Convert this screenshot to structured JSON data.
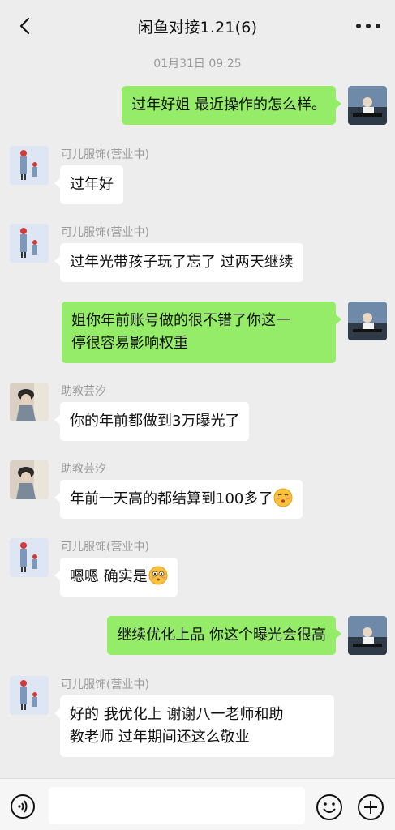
{
  "header": {
    "title": "闲鱼对接1.21(6)",
    "back_icon": "back-chevron-icon",
    "more_icon": "more-dots-icon"
  },
  "chat": {
    "timestamp": "01月31日 09:25",
    "messages": [
      {
        "side": "right",
        "text": "过年好姐 最近操作的怎么样。",
        "avatar": "user-avatar"
      },
      {
        "side": "left",
        "sender": "可儿服饰(营业中)",
        "text": "过年好",
        "avatar": "keer-avatar"
      },
      {
        "side": "left",
        "sender": "可儿服饰(营业中)",
        "text": "过年光带孩子玩了忘了 过两天继续",
        "avatar": "keer-avatar"
      },
      {
        "side": "right",
        "text_line1": "姐你年前账号做的很不错了你这一",
        "text_line2": "停很容易影响权重",
        "avatar": "user-avatar"
      },
      {
        "side": "left",
        "sender": "助教芸汐",
        "text": "你的年前都做到3万曝光了",
        "avatar": "assistant-avatar"
      },
      {
        "side": "left",
        "sender": "助教芸汐",
        "text": "年前一天高的都结算到100多了",
        "emoji": "kiss-emoji",
        "avatar": "assistant-avatar"
      },
      {
        "side": "left",
        "sender": "可儿服饰(营业中)",
        "text": "嗯嗯 确实是",
        "emoji": "flushed-emoji",
        "avatar": "keer-avatar"
      },
      {
        "side": "right",
        "text": "继续优化上品 你这个曝光会很高",
        "avatar": "user-avatar"
      },
      {
        "side": "left",
        "sender": "可儿服饰(营业中)",
        "text_line1": "好的 我优化上  谢谢八一老师和助",
        "text_line2": "教老师 过年期间还这么敬业",
        "avatar": "keer-avatar"
      }
    ]
  },
  "input": {
    "value": "",
    "voice_icon": "voice-icon",
    "emoji_icon": "emoji-face-icon",
    "plus_icon": "plus-icon"
  },
  "colors": {
    "background": "#ededed",
    "bubble_green": "#95ec69",
    "bubble_white": "#ffffff",
    "meta_text": "#9a9a9a"
  }
}
